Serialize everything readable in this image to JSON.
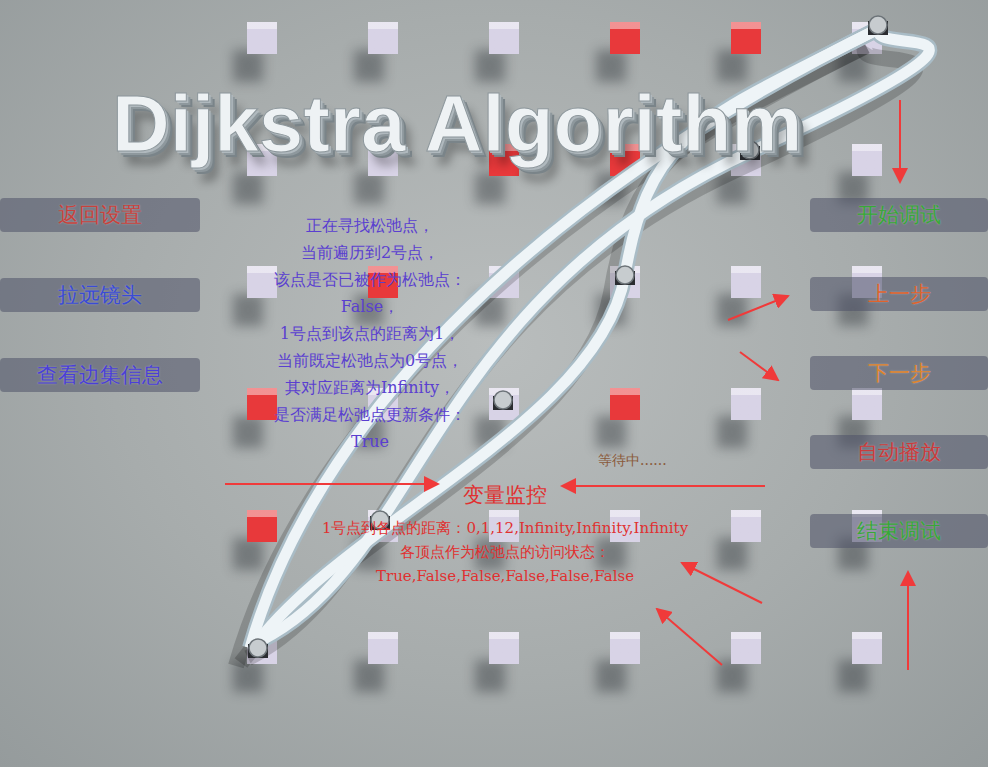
{
  "title": "Dijkstra Algorithm",
  "left_buttons": [
    {
      "label": "返回设置",
      "color": "#c8423c"
    },
    {
      "label": "拉远镜头",
      "color": "#3a4bd6"
    },
    {
      "label": "查看边集信息",
      "color": "#4a3fd8"
    }
  ],
  "right_buttons": [
    {
      "label": "开始调试",
      "color": "#38a838"
    },
    {
      "label": "上一步",
      "color": "#e0632c"
    },
    {
      "label": "下一步",
      "color": "#e0852c"
    },
    {
      "label": "自动播放",
      "color": "#cc3b3b"
    },
    {
      "label": "结束调试",
      "color": "#38a838"
    }
  ],
  "step_info": {
    "lines": [
      "正在寻找松弛点，",
      "当前遍历到2号点，",
      "该点是否已被作为松弛点：",
      "False，",
      "1号点到该点的距离为1，",
      "当前既定松弛点为0号点，",
      "其对应距离为Infinity，",
      "是否满足松弛点更新条件：",
      "True"
    ]
  },
  "status": "等待中......",
  "monitor": {
    "title": "变量监控",
    "lines": [
      "1号点到各点的距离：0,1,12,Infinity,Infinity,Infinity",
      "各顶点作为松弛点的访问状态：",
      "True,False,False,False,False,False"
    ]
  },
  "grid": {
    "rows": [
      [
        {
          "color": "#d8d3e6"
        },
        {
          "color": "#d8d3e6"
        },
        {
          "color": "#d8d3e6"
        },
        {
          "color": "#e8393b"
        },
        {
          "color": "#e8393b"
        },
        {
          "color": "#d8d3e6"
        }
      ],
      [
        {
          "color": "#d8d3e6"
        },
        {
          "color": "#d8d3e6"
        },
        {
          "color": "#e8393b"
        },
        {
          "color": "#e8393b"
        },
        {
          "color": "#d8d3e6"
        },
        {
          "color": "#d8d3e6"
        }
      ],
      [
        {
          "color": "#d8d3e6"
        },
        {
          "color": "#e8393b"
        },
        {
          "color": "#d8d3e6"
        },
        {
          "color": "#d8d3e6"
        },
        {
          "color": "#d8d3e6"
        },
        {
          "color": "#d8d3e6"
        }
      ],
      [
        {
          "color": "#e8393b"
        },
        {
          "color": "#d8d3e6"
        },
        {
          "color": "#d8d3e6"
        },
        {
          "color": "#e8393b"
        },
        {
          "color": "#d8d3e6"
        },
        {
          "color": "#d8d3e6"
        }
      ],
      [
        {
          "color": "#e8393b"
        },
        {
          "color": "#d8d3e6"
        },
        {
          "color": "#d8d3e6"
        },
        {
          "color": "#d8d3e6"
        },
        {
          "color": "#d8d3e6"
        },
        {
          "color": "#d8d3e6"
        }
      ],
      [
        {
          "color": "#d8d3e6"
        },
        {
          "color": "#d8d3e6"
        },
        {
          "color": "#d8d3e6"
        },
        {
          "color": "#d8d3e6"
        },
        {
          "color": "#d8d3e6"
        },
        {
          "color": "#d8d3e6"
        }
      ]
    ]
  }
}
